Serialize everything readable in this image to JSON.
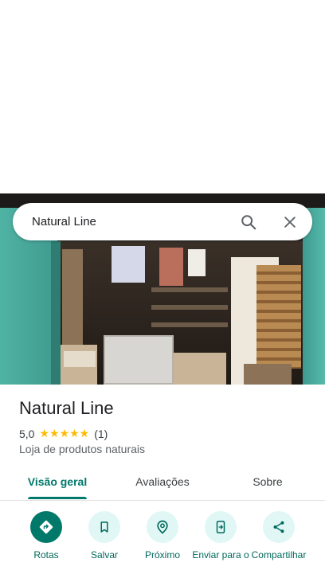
{
  "search": {
    "query": "Natural Line"
  },
  "place": {
    "name": "Natural Line",
    "rating": "5,0",
    "stars": "★★★★★",
    "review_count": "(1)",
    "category": "Loja de produtos naturais"
  },
  "tabs": [
    {
      "label": "Visão geral",
      "active": true
    },
    {
      "label": "Avaliações",
      "active": false
    },
    {
      "label": "Sobre",
      "active": false
    }
  ],
  "actions": [
    {
      "label": "Rotas",
      "icon": "directions-icon"
    },
    {
      "label": "Salvar",
      "icon": "bookmark-icon"
    },
    {
      "label": "Próximo",
      "icon": "nearby-icon"
    },
    {
      "label": "Enviar para o",
      "icon": "send-to-phone-icon"
    },
    {
      "label": "Compartilhar",
      "icon": "share-icon"
    }
  ],
  "colors": {
    "accent": "#00796b",
    "action_bg": "#e0f7f6",
    "star": "#fbbc04"
  }
}
